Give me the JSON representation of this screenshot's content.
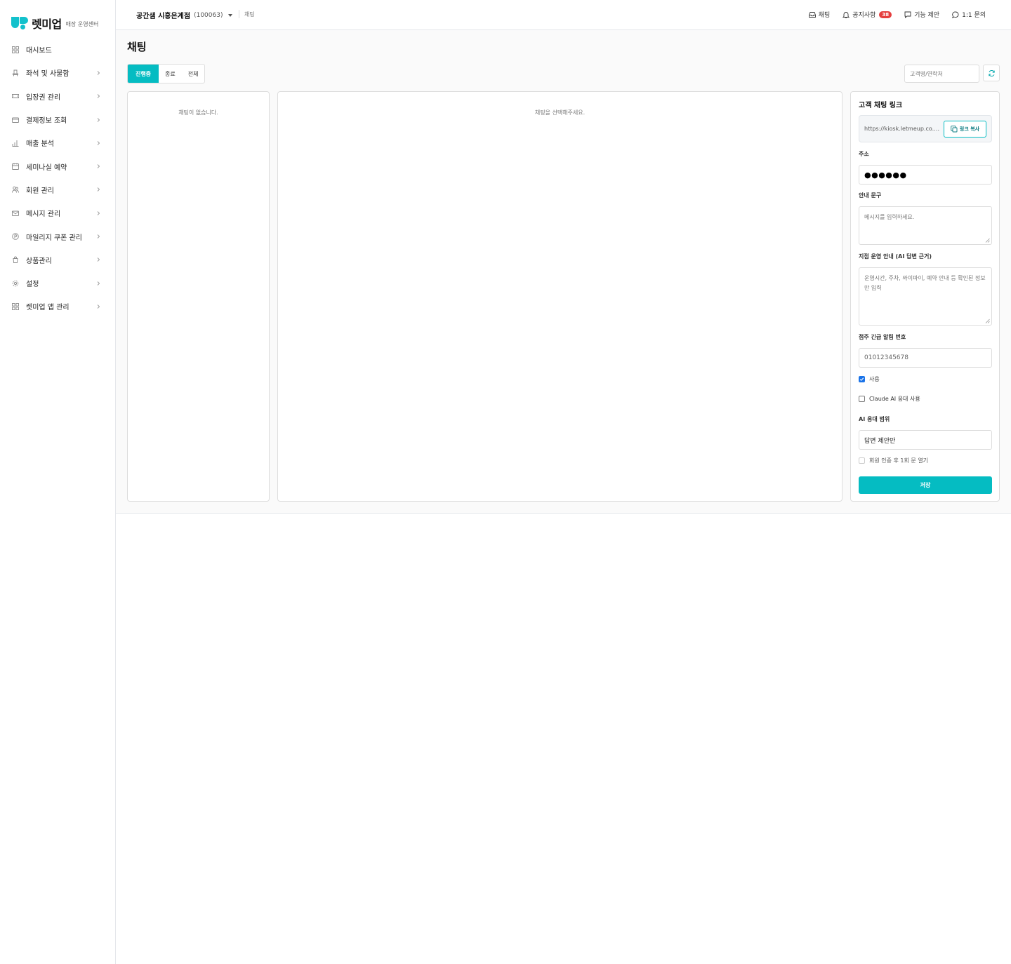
{
  "brand": {
    "name": "렛미업",
    "subtitle": "매장 운영센터",
    "color": "#13c1cc"
  },
  "sidebar": {
    "items": [
      {
        "label": "대시보드",
        "icon": "dashboard-icon",
        "chevron": false
      },
      {
        "label": "좌석 및 사물함",
        "icon": "seat-icon",
        "chevron": true
      },
      {
        "label": "입장권 관리",
        "icon": "ticket-icon",
        "chevron": true
      },
      {
        "label": "결제정보 조회",
        "icon": "card-icon",
        "chevron": true
      },
      {
        "label": "매출 분석",
        "icon": "chart-icon",
        "chevron": true
      },
      {
        "label": "세미나실 예약",
        "icon": "calendar-icon",
        "chevron": true
      },
      {
        "label": "회원 관리",
        "icon": "users-icon",
        "chevron": true
      },
      {
        "label": "메시지 관리",
        "icon": "mail-icon",
        "chevron": true
      },
      {
        "label": "마일리지 쿠폰 관리",
        "icon": "coupon-icon",
        "chevron": true
      },
      {
        "label": "상품관리",
        "icon": "product-icon",
        "chevron": true
      },
      {
        "label": "설정",
        "icon": "gear-icon",
        "chevron": true
      },
      {
        "label": "렛미업 앱 관리",
        "icon": "app-icon",
        "chevron": true
      }
    ]
  },
  "header": {
    "store_name": "공간샘 시흥은계점",
    "store_code": "(100063)",
    "breadcrumb": "채팅",
    "actions": {
      "chat": "채팅",
      "notice": "공지사항",
      "notice_count": "38",
      "suggest": "기능 제안",
      "inquiry": "1:1 문의"
    }
  },
  "main": {
    "title": "채팅",
    "tabs": [
      {
        "label": "진행중",
        "active": true
      },
      {
        "label": "종료",
        "active": false
      },
      {
        "label": "전체",
        "active": false
      }
    ],
    "search_placeholder": "고객명/연락처",
    "list_empty": "채팅이 없습니다.",
    "chat_empty": "채팅을 선택해주세요."
  },
  "settings": {
    "link_title": "고객 채팅 링크",
    "link_url": "https://kiosk.letmeup.co.kr...",
    "copy_label": "링크 복사",
    "address_label": "주소",
    "address_value": "●●●●●●",
    "guide_label": "안내 문구",
    "guide_placeholder": "메시지를 입력하세요.",
    "ops_label": "지점 운영 안내 (AI 답변 근거)",
    "ops_placeholder": "운영시간, 주차, 와이파이, 예약 안내 등 확인된 정보만 입력",
    "emergency_label": "점주 긴급 알림 번호",
    "emergency_value": "01012345678",
    "use_label": "사용",
    "use_checked": true,
    "claude_label": "Claude AI 응대 사용",
    "claude_checked": false,
    "scope_label": "AI 응대 범위",
    "scope_value": "답변 제안만",
    "auth_label": "회원 인증 후 1회 문 열기",
    "save_label": "저장",
    "accent": "#05bcc2"
  }
}
